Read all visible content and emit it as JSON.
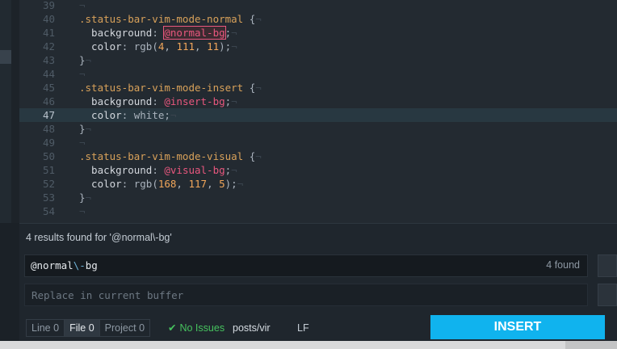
{
  "editor": {
    "lines": [
      {
        "num": "39",
        "segments": []
      },
      {
        "num": "40",
        "segments": [
          {
            "t": ".status-bar-vim-mode-normal",
            "c": "sel-c"
          },
          {
            "t": " {",
            "c": "plain"
          }
        ]
      },
      {
        "num": "41",
        "segments": [
          {
            "t": "  background",
            "c": "prop"
          },
          {
            "t": ": ",
            "c": "plain"
          },
          {
            "t": "@normal-bg",
            "c": "var hl"
          },
          {
            "t": ";",
            "c": "plain"
          }
        ]
      },
      {
        "num": "42",
        "segments": [
          {
            "t": "  color",
            "c": "prop"
          },
          {
            "t": ": rgb(",
            "c": "plain"
          },
          {
            "t": "4",
            "c": "num"
          },
          {
            "t": ", ",
            "c": "plain"
          },
          {
            "t": "111",
            "c": "num"
          },
          {
            "t": ", ",
            "c": "plain"
          },
          {
            "t": "11",
            "c": "num"
          },
          {
            "t": ");",
            "c": "plain"
          }
        ]
      },
      {
        "num": "43",
        "segments": [
          {
            "t": "}",
            "c": "plain"
          }
        ]
      },
      {
        "num": "44",
        "segments": []
      },
      {
        "num": "45",
        "segments": [
          {
            "t": ".status-bar-vim-mode-insert",
            "c": "sel-c"
          },
          {
            "t": " {",
            "c": "plain"
          }
        ]
      },
      {
        "num": "46",
        "segments": [
          {
            "t": "  background",
            "c": "prop"
          },
          {
            "t": ": ",
            "c": "plain"
          },
          {
            "t": "@insert-bg",
            "c": "var"
          },
          {
            "t": ";",
            "c": "plain"
          }
        ]
      },
      {
        "num": "47",
        "segments": [
          {
            "t": "  color",
            "c": "prop"
          },
          {
            "t": ": white;",
            "c": "plain"
          }
        ],
        "cursor": true
      },
      {
        "num": "48",
        "segments": [
          {
            "t": "}",
            "c": "plain"
          }
        ]
      },
      {
        "num": "49",
        "segments": []
      },
      {
        "num": "50",
        "segments": [
          {
            "t": ".status-bar-vim-mode-visual",
            "c": "sel-c"
          },
          {
            "t": " {",
            "c": "plain"
          }
        ]
      },
      {
        "num": "51",
        "segments": [
          {
            "t": "  background",
            "c": "prop"
          },
          {
            "t": ": ",
            "c": "plain"
          },
          {
            "t": "@visual-bg",
            "c": "var"
          },
          {
            "t": ";",
            "c": "plain"
          }
        ]
      },
      {
        "num": "52",
        "segments": [
          {
            "t": "  color",
            "c": "prop"
          },
          {
            "t": ": rgb(",
            "c": "plain"
          },
          {
            "t": "168",
            "c": "num"
          },
          {
            "t": ", ",
            "c": "plain"
          },
          {
            "t": "117",
            "c": "num"
          },
          {
            "t": ", ",
            "c": "plain"
          },
          {
            "t": "5",
            "c": "num"
          },
          {
            "t": ");",
            "c": "plain"
          }
        ]
      },
      {
        "num": "53",
        "segments": [
          {
            "t": "}",
            "c": "plain"
          }
        ]
      },
      {
        "num": "54",
        "segments": []
      }
    ],
    "invisible_char": "¬"
  },
  "find": {
    "results_text": "4 results found for '@normal\\-bg'",
    "query_prefix": "@normal",
    "query_escape": "\\-",
    "query_suffix": "bg",
    "query_value": "@normal\\-bg",
    "count": "4 found",
    "replace_placeholder": "Replace in current buffer"
  },
  "status": {
    "scopes": [
      {
        "label": "Line",
        "count": "0",
        "active": false
      },
      {
        "label": "File",
        "count": "0",
        "active": true
      },
      {
        "label": "Project",
        "count": "0",
        "active": false
      }
    ],
    "issues_icon": "check-icon",
    "issues_glyph": "✔",
    "issues_text": "No Issues",
    "path": "posts/vir",
    "eol": "LF",
    "vim_mode": "INSERT"
  },
  "colors": {
    "vim_insert": "#10b3ee",
    "issues_ok": "#46c25e",
    "variable": "#e8577e",
    "selector": "#d8a15a",
    "number": "#f0a65a"
  }
}
